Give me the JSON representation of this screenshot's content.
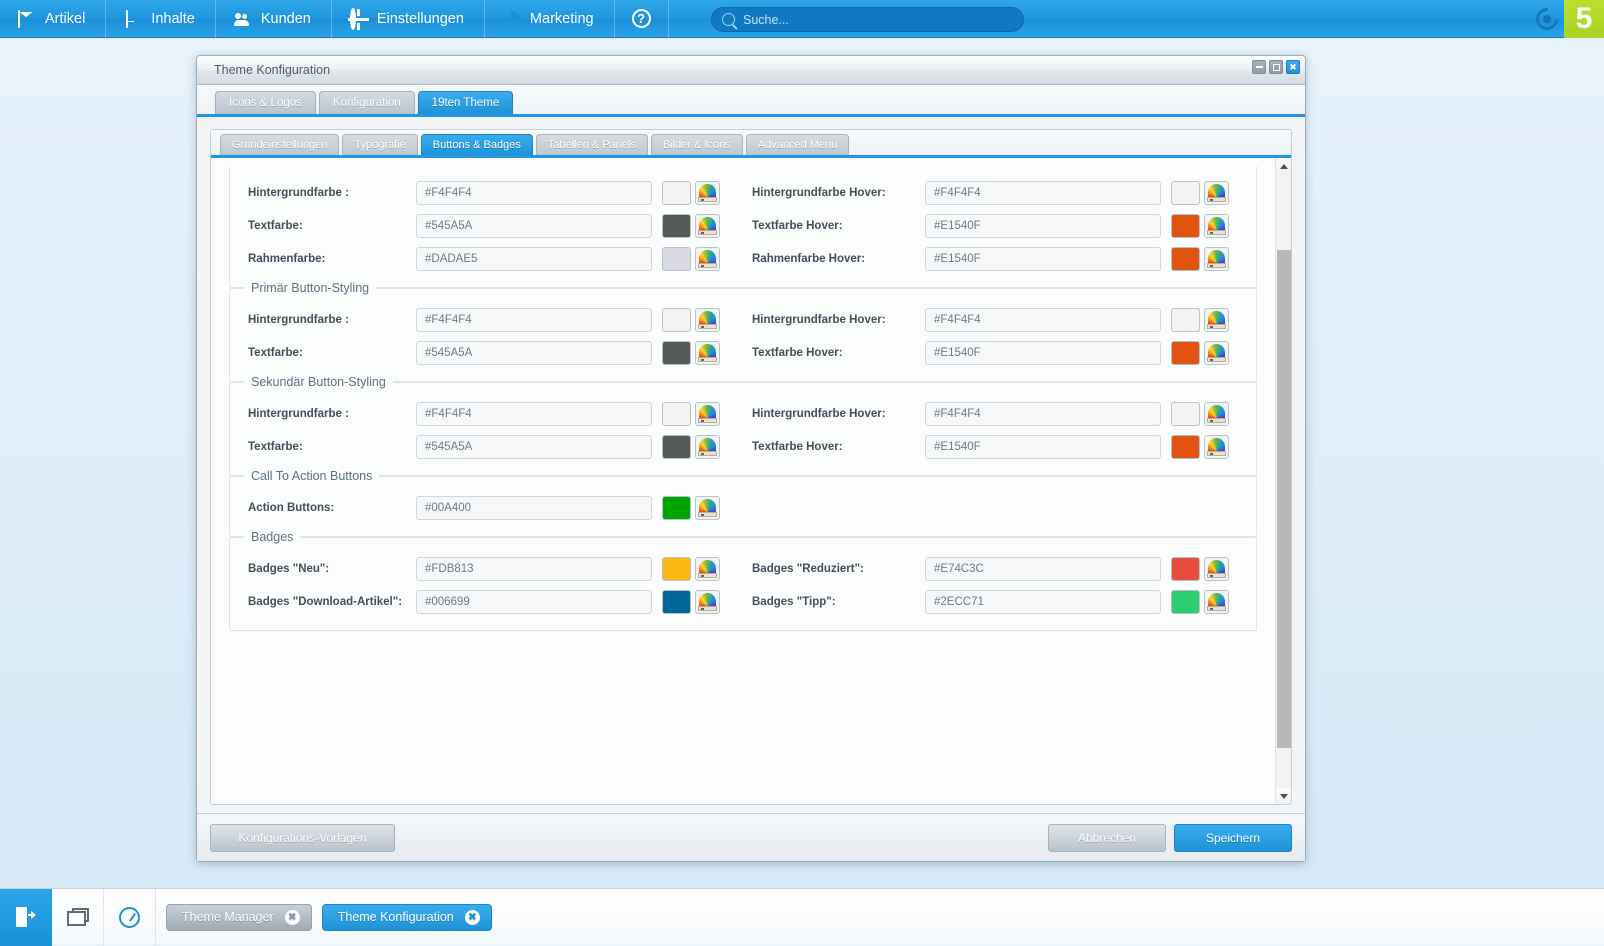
{
  "topnav": {
    "items": [
      {
        "label": "Artikel",
        "icon": "mail-icon"
      },
      {
        "label": "Inhalte",
        "icon": "page-icon"
      },
      {
        "label": "Kunden",
        "icon": "users-icon"
      },
      {
        "label": "Einstellungen",
        "icon": "gear-icon"
      },
      {
        "label": "Marketing",
        "icon": "pie-chart-icon"
      }
    ],
    "help_label": "?",
    "search_placeholder": "Suche...",
    "brand_version": "5"
  },
  "window": {
    "title": "Theme Konfiguration",
    "controls": {
      "minimize": "minimize-icon",
      "maximize": "maximize-icon",
      "close": "✖"
    },
    "outer_tabs": [
      {
        "label": "Icons & Logos",
        "selected": false
      },
      {
        "label": "Konfiguration",
        "selected": false
      },
      {
        "label": "19ten Theme",
        "selected": true
      }
    ],
    "inner_tabs": [
      {
        "label": "Grundeinstellungen",
        "selected": false
      },
      {
        "label": "Typografie",
        "selected": false
      },
      {
        "label": "Buttons & Badges",
        "selected": true
      },
      {
        "label": "Tabellen & Panels",
        "selected": false
      },
      {
        "label": "Bilder & Icons",
        "selected": false
      },
      {
        "label": "Advanced Menu",
        "selected": false
      }
    ]
  },
  "sections": [
    {
      "legend": "",
      "rows": [
        {
          "left": {
            "label": "Hintergrundfarbe :",
            "value": "#F4F4F4",
            "swatch": "#F4F4F4"
          },
          "right": {
            "label": "Hintergrundfarbe Hover:",
            "value": "#F4F4F4",
            "swatch": "#F4F4F4"
          }
        },
        {
          "left": {
            "label": "Textfarbe:",
            "value": "#545A5A",
            "swatch": "#545A5A"
          },
          "right": {
            "label": "Textfarbe Hover:",
            "value": "#E1540F",
            "swatch": "#E1540F"
          }
        },
        {
          "left": {
            "label": "Rahmenfarbe:",
            "value": "#DADAE5",
            "swatch": "#DADAE5"
          },
          "right": {
            "label": "Rahmenfarbe Hover:",
            "value": "#E1540F",
            "swatch": "#E1540F"
          }
        }
      ]
    },
    {
      "legend": "Primär Button-Styling",
      "rows": [
        {
          "left": {
            "label": "Hintergrundfarbe :",
            "value": "#F4F4F4",
            "swatch": "#F4F4F4"
          },
          "right": {
            "label": "Hintergrundfarbe Hover:",
            "value": "#F4F4F4",
            "swatch": "#F4F4F4"
          }
        },
        {
          "left": {
            "label": "Textfarbe:",
            "value": "#545A5A",
            "swatch": "#545A5A"
          },
          "right": {
            "label": "Textfarbe Hover:",
            "value": "#E1540F",
            "swatch": "#E1540F"
          }
        }
      ]
    },
    {
      "legend": "Sekundär Button-Styling",
      "rows": [
        {
          "left": {
            "label": "Hintergrundfarbe :",
            "value": "#F4F4F4",
            "swatch": "#F4F4F4"
          },
          "right": {
            "label": "Hintergrundfarbe Hover:",
            "value": "#F4F4F4",
            "swatch": "#F4F4F4"
          }
        },
        {
          "left": {
            "label": "Textfarbe:",
            "value": "#545A5A",
            "swatch": "#545A5A"
          },
          "right": {
            "label": "Textfarbe Hover:",
            "value": "#E1540F",
            "swatch": "#E1540F"
          }
        }
      ]
    },
    {
      "legend": "Call To Action Buttons",
      "rows": [
        {
          "left": {
            "label": "Action Buttons:",
            "value": "#00A400",
            "swatch": "#00A400"
          },
          "right": null
        }
      ]
    },
    {
      "legend": "Badges",
      "rows": [
        {
          "left": {
            "label": "Badges \"Neu\":",
            "value": "#FDB813",
            "swatch": "#FDB813"
          },
          "right": {
            "label": "Badges \"Reduziert\":",
            "value": "#E74C3C",
            "swatch": "#E74C3C"
          }
        },
        {
          "left": {
            "label": "Badges \"Download-Artikel\":",
            "value": "#006699",
            "swatch": "#006699"
          },
          "right": {
            "label": "Badges \"Tipp\":",
            "value": "#2ECC71",
            "swatch": "#2ECC71"
          }
        }
      ]
    }
  ],
  "footer": {
    "templates_label": "Konfigurations-Vorlagen",
    "cancel_label": "Abbrechen",
    "save_label": "Speichern"
  },
  "taskbar": {
    "logout_icon": "logout-icon",
    "windows_icon": "windows-icon",
    "gauge_icon": "gauge-icon",
    "buttons": [
      {
        "label": "Theme Manager",
        "active": false
      },
      {
        "label": "Theme Konfiguration",
        "active": true
      }
    ]
  },
  "colors": {
    "accent": "#1f92d8",
    "brand_green": "#b0d82b",
    "window_bg": "#f2f4f6"
  }
}
